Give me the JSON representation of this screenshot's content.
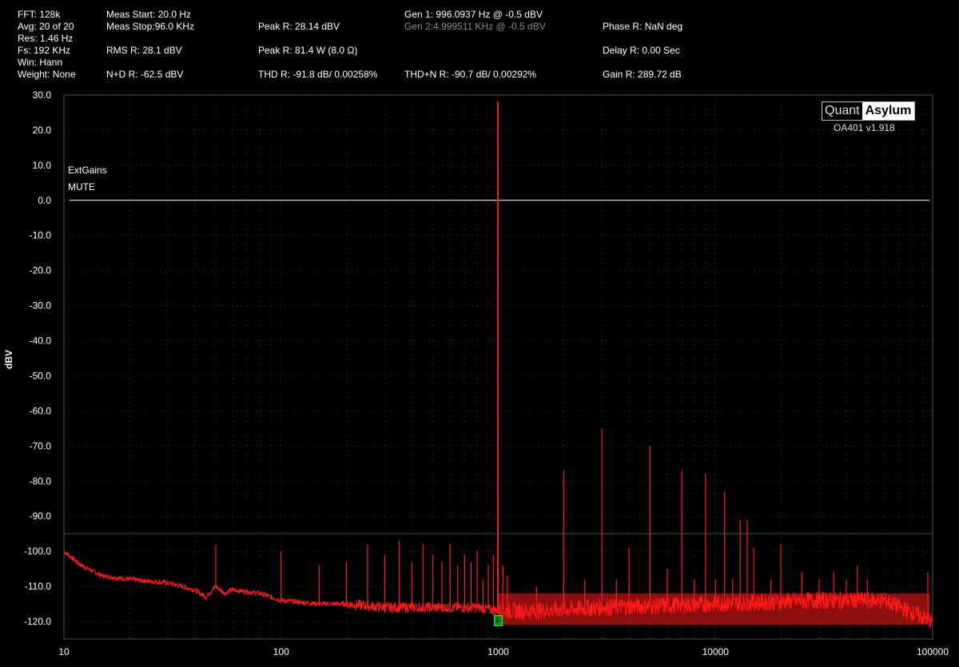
{
  "header": {
    "fft": "FFT: 128k",
    "avg": "Avg: 20 of 20",
    "res": "Res: 1.46 Hz",
    "fs": "Fs: 192 KHz",
    "win": "Win: Hann",
    "weight": "Weight: None",
    "meas_start": "Meas Start: 20.0 Hz",
    "meas_stop": "Meas Stop:96.0 KHz",
    "rms": "RMS R: 28.1 dBV",
    "nd": "N+D R: -62.5 dBV",
    "peak_r": "Peak R: 28.14 dBV",
    "peak_w": "Peak R: 81.4 W (8.0 Ω)",
    "thd": "THD R: -91.8 dB/ 0.00258%",
    "gen1": "Gen 1: 996.0937 Hz @ -0.5  dBV",
    "gen2": "Gen 2:4.999511 KHz @ -0.5  dBV",
    "thdn": "THD+N R: -90.7 dB/ 0.00292%",
    "phase": "Phase R: NaN deg",
    "delay": "Delay R: 0.00 Sec",
    "gain": "Gain R: 289.72 dB"
  },
  "logo": {
    "quant": "Quant",
    "asylum": "Asylum",
    "version": "OA401 v1.918"
  },
  "notes": {
    "extgains": "ExtGains",
    "mute": "MUTE"
  },
  "marker_label": "F",
  "colors": {
    "trace": "#ff1a1a",
    "grid": "#3a3a3a",
    "ref_line": "#ffffff",
    "threshold_line": "#1f5f1f"
  },
  "chart_data": {
    "type": "line",
    "xlabel": "",
    "ylabel": "dBV",
    "x_scale": "log",
    "xlim": [
      10,
      100000
    ],
    "ylim": [
      -125,
      30
    ],
    "x_ticks": [
      "10",
      "100",
      "1000",
      "10000",
      "100000"
    ],
    "y_ticks": [
      "30.0",
      "20.0",
      "10.0",
      "0.0",
      "-10.0",
      "-20.0",
      "-30.0",
      "-40.0",
      "-50.0",
      "-60.0",
      "-70.0",
      "-80.0",
      "-90.0",
      "-100.0",
      "-110.0",
      "-120.0"
    ],
    "reference_line_dbv": 0,
    "threshold_line_dbv": -95,
    "noise_floor": {
      "x": [
        10,
        12,
        15,
        20,
        30,
        40,
        45,
        50,
        55,
        60,
        80,
        100,
        150,
        200,
        300,
        500,
        800,
        1000,
        1500,
        3000,
        10000,
        30000,
        60000,
        100000
      ],
      "y": [
        -100,
        -104,
        -107,
        -108,
        -109,
        -111,
        -113,
        -110,
        -112,
        -111,
        -112,
        -114,
        -115,
        -115,
        -116,
        -116,
        -116,
        -117,
        -117,
        -116,
        -115,
        -114,
        -114,
        -120
      ]
    },
    "peaks": {
      "x": [
        50,
        100,
        150,
        200,
        250,
        300,
        350,
        400,
        450,
        500,
        550,
        600,
        650,
        700,
        750,
        800,
        850,
        900,
        950,
        996.0937,
        1050,
        1100,
        1500,
        2000,
        2500,
        3000,
        3500,
        4000,
        5000,
        6000,
        7000,
        8000,
        9000,
        10000,
        11000,
        12000,
        13000,
        14000,
        15000,
        18000,
        20000,
        25000,
        30000,
        35000,
        40000,
        45000,
        50000,
        95000
      ],
      "y": [
        -98,
        -100,
        -104,
        -103,
        -98,
        -101,
        -97,
        -103,
        -98,
        -101,
        -103,
        -98,
        -104,
        -101,
        -103,
        -100,
        -108,
        -104,
        -101,
        28.14,
        -104,
        -107,
        -110,
        -77,
        -108,
        -65,
        -108,
        -99,
        -70,
        -105,
        -77,
        -108,
        -78,
        -108,
        -83,
        -108,
        -91,
        -91,
        -99,
        -108,
        -98,
        -106,
        -108,
        -106,
        -108,
        -104,
        -108,
        -106
      ]
    }
  }
}
